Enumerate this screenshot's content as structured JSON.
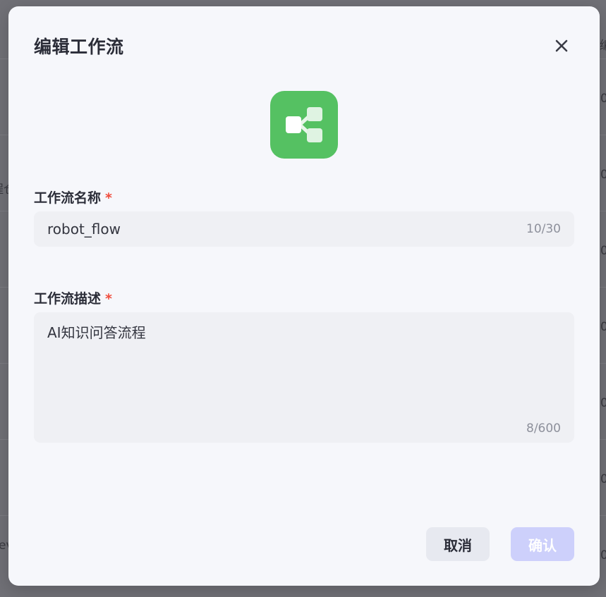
{
  "background": {
    "peek_texts": [
      "编",
      "0",
      "0",
      "程仓",
      "0",
      "0",
      "0",
      "0",
      "ev",
      "0"
    ]
  },
  "modal": {
    "title": "编辑工作流",
    "close_icon": "close-icon",
    "app_icon": {
      "name": "workflow-share-icon",
      "color": "#55c162"
    },
    "name_field": {
      "label": "工作流名称",
      "required_mark": "*",
      "value": "robot_flow",
      "counter": "10/30"
    },
    "description_field": {
      "label": "工作流描述",
      "required_mark": "*",
      "value": "AI知识问答流程",
      "counter": "8/600"
    },
    "footer": {
      "cancel_label": "取消",
      "confirm_label": "确认"
    }
  },
  "colors": {
    "required": "#f04c3c",
    "primary_disabled": "#cdd0fb",
    "icon_green": "#55c162"
  }
}
